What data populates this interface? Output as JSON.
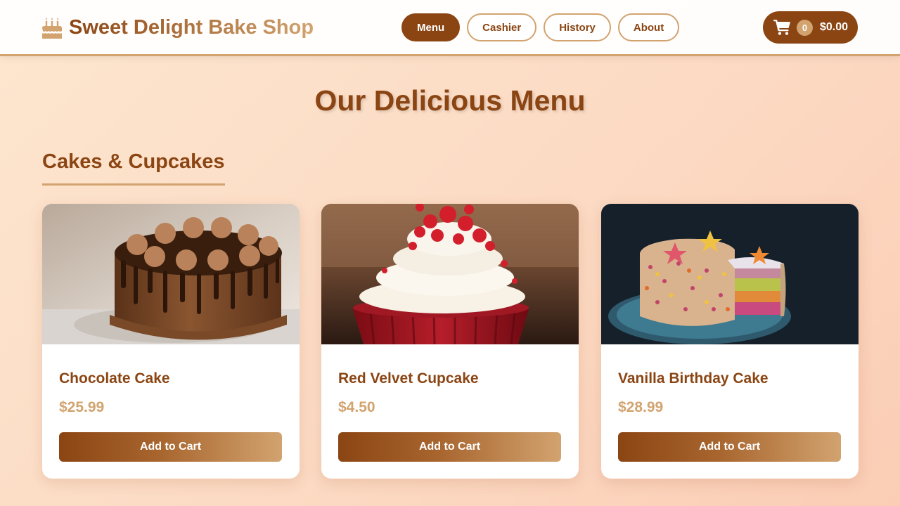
{
  "header": {
    "brand": "Sweet Delight Bake Shop",
    "brand_icon": "birthday-cake-icon",
    "nav": [
      {
        "label": "Menu",
        "active": true
      },
      {
        "label": "Cashier",
        "active": false
      },
      {
        "label": "History",
        "active": false
      },
      {
        "label": "About",
        "active": false
      }
    ],
    "cart": {
      "icon": "shopping-cart-icon",
      "count": "0",
      "total": "$0.00"
    }
  },
  "main": {
    "title": "Our Delicious Menu",
    "section_title": "Cakes & Cupcakes",
    "products": [
      {
        "name": "Chocolate Cake",
        "price": "$25.99",
        "button": "Add to Cart"
      },
      {
        "name": "Red Velvet Cupcake",
        "price": "$4.50",
        "button": "Add to Cart"
      },
      {
        "name": "Vanilla Birthday Cake",
        "price": "$28.99",
        "button": "Add to Cart"
      }
    ]
  },
  "colors": {
    "primary": "#8b4513",
    "accent": "#d2a36f",
    "background": "#fde6cf"
  }
}
